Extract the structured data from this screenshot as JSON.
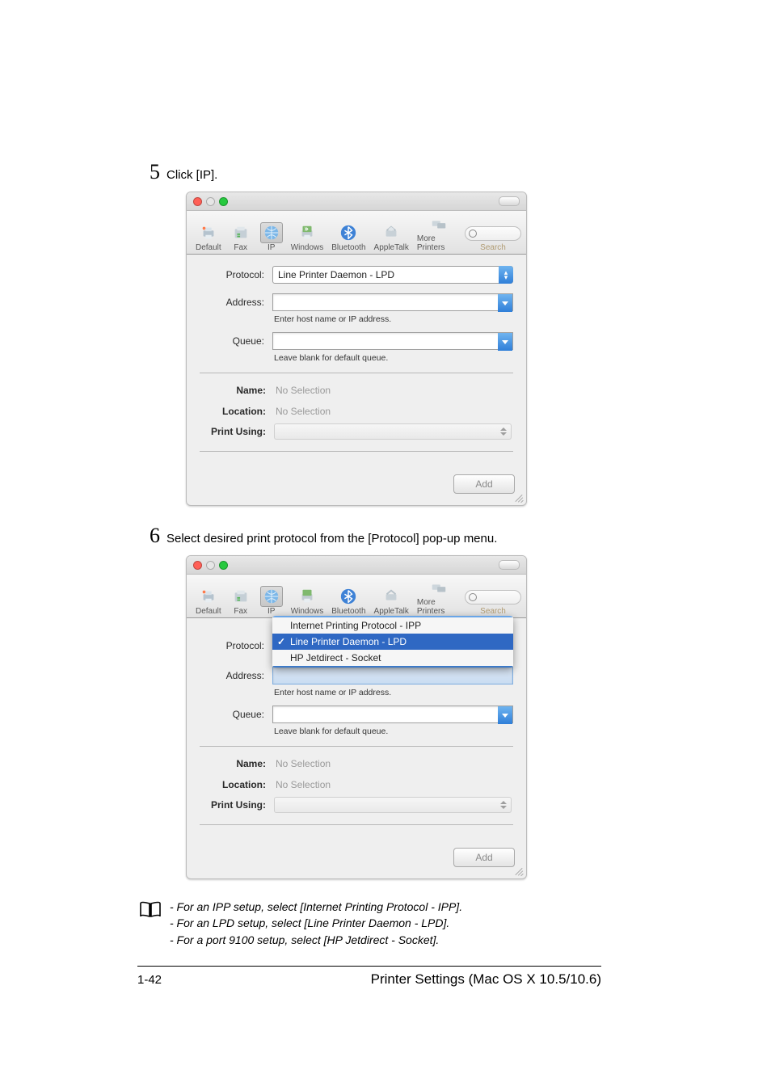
{
  "step1": {
    "num": "5",
    "text": "Click [IP]."
  },
  "step2": {
    "num": "6",
    "text": "Select desired print protocol from the [Protocol] pop-up menu."
  },
  "shot": {
    "toolbar": {
      "default": "Default",
      "fax": "Fax",
      "ip": "IP",
      "windows": "Windows",
      "bluetooth": "Bluetooth",
      "appletalk": "AppleTalk",
      "more": "More Printers",
      "search": "Search"
    },
    "labels": {
      "protocol": "Protocol:",
      "address": "Address:",
      "queue": "Queue:",
      "name": "Name:",
      "location": "Location:",
      "printusing": "Print Using:"
    },
    "values": {
      "protocol": "Line Printer Daemon - LPD",
      "address": "",
      "queue": "",
      "name": "No Selection",
      "location": "No Selection",
      "printusing": ""
    },
    "hints": {
      "address": "Enter host name or IP address.",
      "queue": "Leave blank for default queue."
    },
    "menu": {
      "ipp": "Internet Printing Protocol - IPP",
      "lpd": "Line Printer Daemon - LPD",
      "socket": "HP Jetdirect - Socket"
    },
    "add": "Add"
  },
  "note": {
    "l1": "- For an IPP setup, select [Internet Printing Protocol - IPP].",
    "l2": "- For an LPD setup, select [Line Printer Daemon - LPD].",
    "l3": "- For a port 9100 setup, select [HP Jetdirect - Socket]."
  },
  "footer": {
    "pagenum": "1-42",
    "title": "Printer Settings (Mac OS X 10.5/10.6)"
  }
}
